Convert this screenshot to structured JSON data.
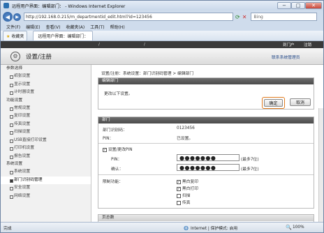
{
  "window": {
    "title": "远程用户界面：编辑部门： - Windows Internet Explorer",
    "min": "−",
    "max": "□",
    "close": "✕"
  },
  "address": {
    "url": "http://192.168.0.215/m_departmentid_edit.html?id=123456",
    "search_placeholder": "Bing"
  },
  "menu": [
    "文件(F)",
    "编辑(E)",
    "查看(V)",
    "收藏夹(A)",
    "工具(T)",
    "帮助(H)"
  ],
  "favbar": {
    "fav_label": "收藏夹",
    "tab_label": "远程用户界面：编辑部门："
  },
  "topbar": {
    "sep": "/",
    "logout": "注销",
    "to_top": "到门户"
  },
  "header": {
    "title": "设置/注册",
    "admin_link": "联系系统管理员"
  },
  "sidebar": {
    "groups": [
      {
        "label": "参数选择",
        "items": [
          "纸张设置",
          "显示设置",
          "计时器设置"
        ]
      },
      {
        "label": "功能设置",
        "items": [
          "常规设置",
          "复印设置",
          "传真设置",
          "扫描设置",
          "USB直接打印设置",
          "打印机设置",
          "报告设置"
        ]
      },
      {
        "label": "系统设置",
        "items": [
          "系统设置",
          "部门识别码管理",
          "安全设置",
          "网络设置"
        ]
      }
    ]
  },
  "breadcrumb": "设置/注册：系统设置：部门识别码管理 > 编辑部门",
  "edit": {
    "header": "编辑部门",
    "prompt": "更改以下设置。",
    "ok": "确定",
    "cancel": "取消"
  },
  "dept": {
    "header": "部门",
    "id_label": "部门识别码：",
    "id_value": "0123456",
    "pin_label": "PIN：",
    "pin_value": "已设置。"
  },
  "pin": {
    "checkbox_label": "设置/更改PIN",
    "pin_label": "PIN：",
    "confirm_label": "确认：",
    "pin_value": "●●●●●●●",
    "confirm_value": "●●●●●●●",
    "max_hint": "(最多7位)"
  },
  "restrict": {
    "label": "限制功能：",
    "items": [
      {
        "label": "黑白复印",
        "checked": true
      },
      {
        "label": "黑白打印",
        "checked": true
      },
      {
        "label": "扫描",
        "checked": false
      },
      {
        "label": "传真",
        "checked": false
      }
    ]
  },
  "pages": {
    "header": "页总数"
  },
  "status": {
    "left": "完成",
    "zone": "Internet | 保护模式: 启用",
    "zoom": "100%"
  }
}
